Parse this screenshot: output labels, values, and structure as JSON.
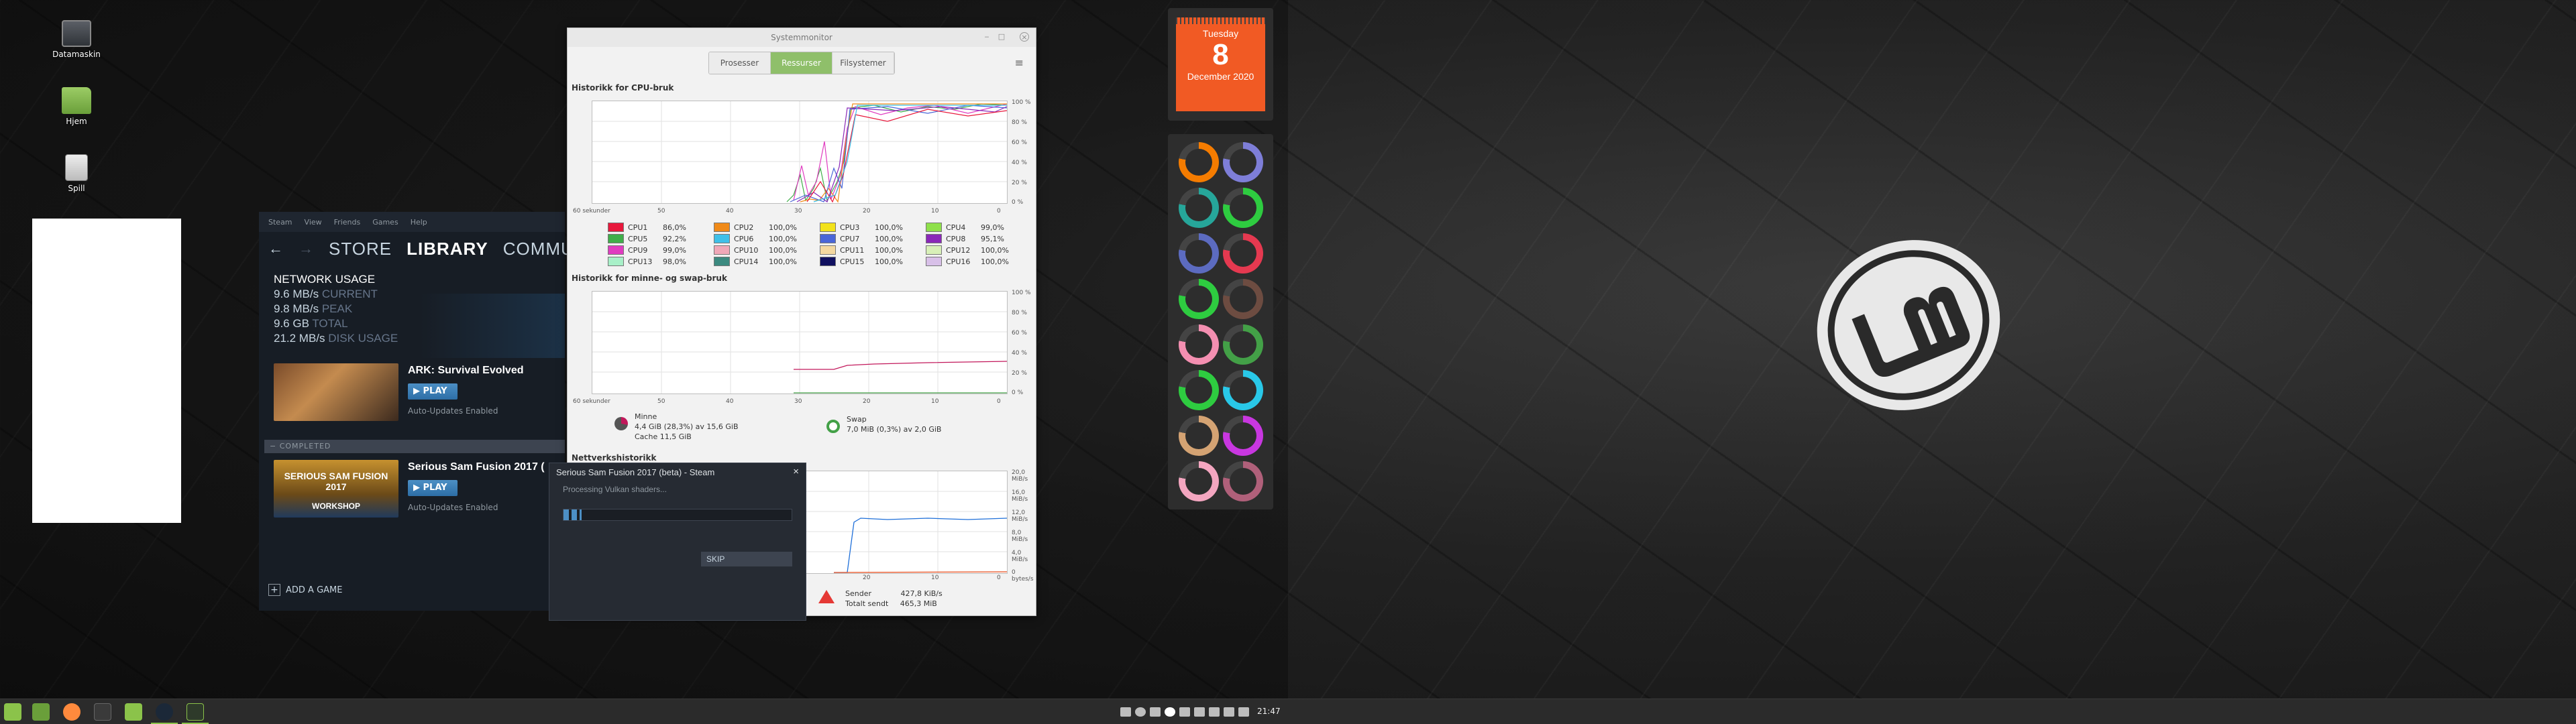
{
  "desktop": {
    "icons": [
      {
        "label": "Datamaskin",
        "icon": "computer-icon"
      },
      {
        "label": "Hjem",
        "icon": "home-folder-icon"
      },
      {
        "label": "Spill",
        "icon": "games-icon"
      }
    ]
  },
  "steam": {
    "menu": [
      "Steam",
      "View",
      "Friends",
      "Games",
      "Help"
    ],
    "nav": {
      "store": "STORE",
      "library": "LIBRARY",
      "community": "COMMUNITY",
      "cut": "I"
    },
    "network": {
      "title": "NETWORK USAGE",
      "current": "9.6 MB/s",
      "current_label": "CURRENT",
      "peak": "9.8 MB/s",
      "peak_label": "PEAK",
      "total": "9.6 GB",
      "total_label": "TOTAL",
      "disk": "21.2 MB/s",
      "disk_label": "DISK USAGE"
    },
    "games": [
      {
        "title": "ARK: Survival Evolved",
        "play": "PLAY",
        "auto": "Auto-Updates Enabled"
      },
      {
        "title": "Serious Sam Fusion 2017 (",
        "play": "PLAY",
        "auto": "Auto-Updates Enabled",
        "art_text": "SERIOUS SAM FUSION 2017",
        "art_sub": "WORKSHOP"
      }
    ],
    "completed": "COMPLETED",
    "add_game": "ADD A GAME"
  },
  "steam_dialog": {
    "title": "Serious Sam Fusion 2017 (beta) - Steam",
    "message": "Processing Vulkan shaders...",
    "progress": 0.08,
    "skip": "SKIP"
  },
  "sysmon": {
    "window_title": "Systemmonitor",
    "tabs": [
      "Prosesser",
      "Ressurser",
      "Filsystemer"
    ],
    "active_tab": "Ressurser",
    "cpu_heading": "Historikk for CPU-bruk",
    "mem_heading": "Historikk for minne- og swap-bruk",
    "net_heading": "Nettverkshistorikk",
    "pct_ticks": [
      "100 %",
      "80 %",
      "60 %",
      "40 %",
      "20 %",
      "0 %"
    ],
    "net_ticks": [
      "20,0 MiB/s",
      "16,0 MiB/s",
      "12,0 MiB/s",
      "8,0 MiB/s",
      "4,0 MiB/s",
      "0 bytes/s"
    ],
    "x_ticks": [
      "60 sekunder",
      "50",
      "40",
      "30",
      "20",
      "10",
      "0"
    ],
    "cpus": [
      {
        "name": "CPU1",
        "val": "86,0%",
        "color": "#e8183c"
      },
      {
        "name": "CPU2",
        "val": "100,0%",
        "color": "#f08a18"
      },
      {
        "name": "CPU3",
        "val": "100,0%",
        "color": "#f2e21a"
      },
      {
        "name": "CPU4",
        "val": "99,0%",
        "color": "#8ee04a"
      },
      {
        "name": "CPU5",
        "val": "92,2%",
        "color": "#3fae49"
      },
      {
        "name": "CPU6",
        "val": "100,0%",
        "color": "#3fc0e8"
      },
      {
        "name": "CPU7",
        "val": "100,0%",
        "color": "#4a66d8"
      },
      {
        "name": "CPU8",
        "val": "95,1%",
        "color": "#8a28b8"
      },
      {
        "name": "CPU9",
        "val": "99,0%",
        "color": "#e03cc0"
      },
      {
        "name": "CPU10",
        "val": "100,0%",
        "color": "#f0a8b8"
      },
      {
        "name": "CPU11",
        "val": "100,0%",
        "color": "#f4d8a0"
      },
      {
        "name": "CPU12",
        "val": "100,0%",
        "color": "#d8f0b8"
      },
      {
        "name": "CPU13",
        "val": "98,0%",
        "color": "#a8f0c8"
      },
      {
        "name": "CPU14",
        "val": "100,0%",
        "color": "#3c8a80"
      },
      {
        "name": "CPU15",
        "val": "100,0%",
        "color": "#101060"
      },
      {
        "name": "CPU16",
        "val": "100,0%",
        "color": "#d8c0e8"
      }
    ],
    "memory": {
      "label": "Minne",
      "used": "4,4 GiB (28,3%) av 15,6 GiB",
      "cache": "Cache 11,5 GiB"
    },
    "swap": {
      "label": "Swap",
      "used": "7,0 MiB (0,3%) av 2,0 GiB"
    },
    "net": {
      "send_label": "Sender",
      "send": "427,8 KiB/s",
      "total_label": "Totalt sendt",
      "total": "465,3 MiB"
    }
  },
  "calendar": {
    "weekday": "Tuesday",
    "day": "8",
    "month_year": "December 2020"
  },
  "conky": {
    "rings": [
      "#f57c00",
      "#7e7ed8",
      "#26a69a",
      "#2ecc40",
      "#5c6bc0",
      "#e53950",
      "#2ecc40",
      "#6d4c41",
      "#f48fb1",
      "#43a047",
      "#2ecc40",
      "#29c8e8",
      "#d4a373",
      "#c837e0",
      "#f4a6c0",
      "#b0607a"
    ]
  },
  "taskbar": {
    "clock": "21:47"
  }
}
